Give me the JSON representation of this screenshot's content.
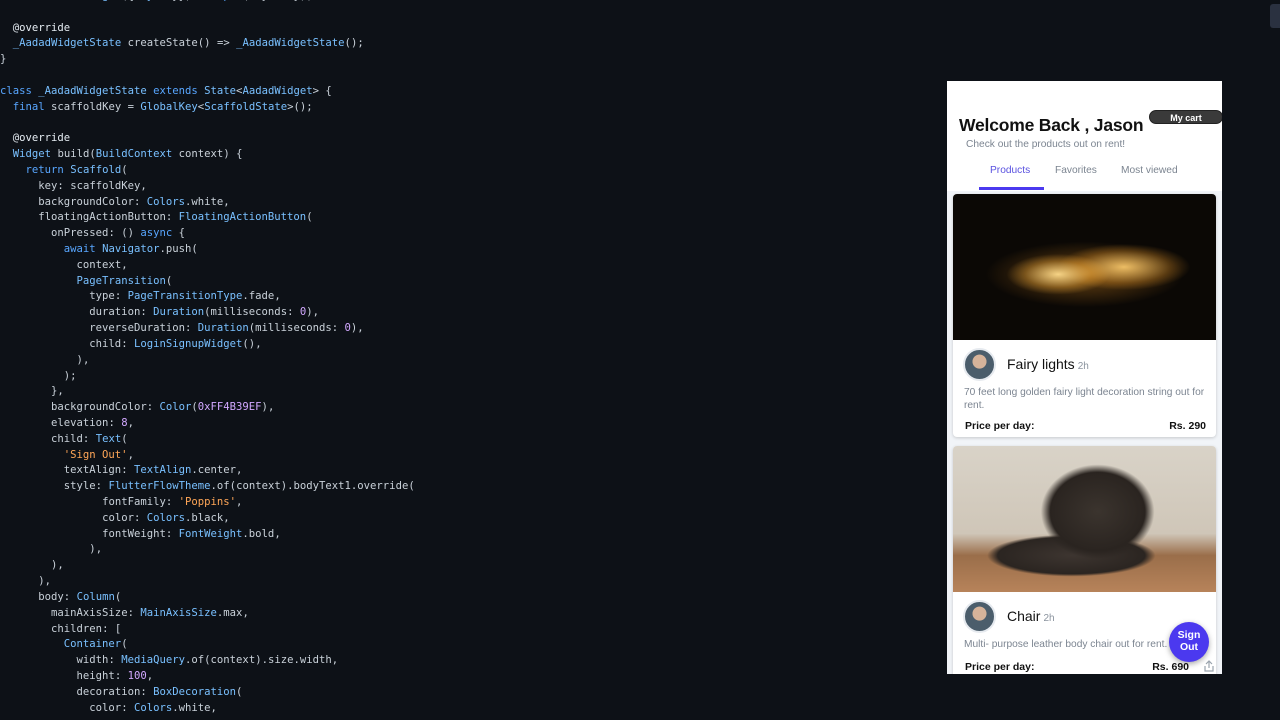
{
  "editor": {
    "code_lines": [
      "  const AadadWidget({Key key}) : super(key: key);",
      "",
      "  @override",
      "  _AadadWidgetState createState() => _AadadWidgetState();",
      "}",
      "",
      "class _AadadWidgetState extends State<AadadWidget> {",
      "  final scaffoldKey = GlobalKey<ScaffoldState>();",
      "",
      "  @override",
      "  Widget build(BuildContext context) {",
      "    return Scaffold(",
      "      key: scaffoldKey,",
      "      backgroundColor: Colors.white,",
      "      floatingActionButton: FloatingActionButton(",
      "        onPressed: () async {",
      "          await Navigator.push(",
      "            context,",
      "            PageTransition(",
      "              type: PageTransitionType.fade,",
      "              duration: Duration(milliseconds: 0),",
      "              reverseDuration: Duration(milliseconds: 0),",
      "              child: LoginSignupWidget(),",
      "            ),",
      "          );",
      "        },",
      "        backgroundColor: Color(0xFF4B39EF),",
      "        elevation: 8,",
      "        child: Text(",
      "          'Sign Out',",
      "          textAlign: TextAlign.center,",
      "          style: FlutterFlowTheme.of(context).bodyText1.override(",
      "                fontFamily: 'Poppins',",
      "                color: Colors.black,",
      "                fontWeight: FontWeight.bold,",
      "              ),",
      "        ),",
      "      ),",
      "      body: Column(",
      "        mainAxisSize: MainAxisSize.max,",
      "        children: [",
      "          Container(",
      "            width: MediaQuery.of(context).size.width,",
      "            height: 100,",
      "            decoration: BoxDecoration(",
      "              color: Colors.white,"
    ]
  },
  "app": {
    "welcome": "Welcome Back , Jason",
    "cart_button": "My cart",
    "subtitle": "Check out the products out on rent!",
    "tabs": [
      {
        "label": "Products",
        "active": true
      },
      {
        "label": "Favorites",
        "active": false
      },
      {
        "label": "Most viewed",
        "active": false
      }
    ],
    "products": [
      {
        "name": "Fairy lights",
        "time": "2h",
        "description": "70 feet long golden fairy light decoration string out for rent.",
        "price_label": "Price per day:",
        "price": "Rs. 290"
      },
      {
        "name": "Chair",
        "time": "2h",
        "description": "Multi- purpose leather body chair out for rent.",
        "price_label": "Price per day:",
        "price": "Rs. 690"
      }
    ],
    "fab_label_line1": "Sign",
    "fab_label_line2": "Out",
    "accent_color": "#4B39EF"
  },
  "icons": {
    "share": "share-icon",
    "avatar": "avatar"
  }
}
